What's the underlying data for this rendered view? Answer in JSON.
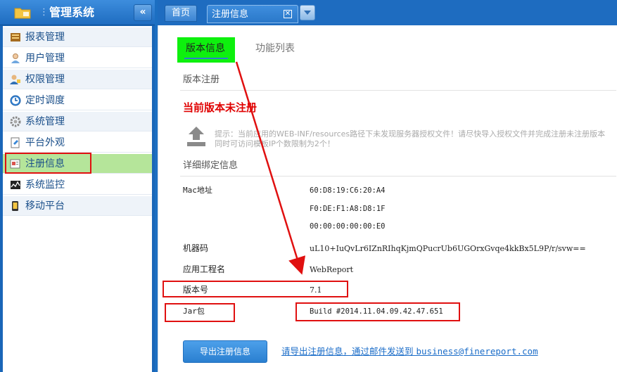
{
  "sidebar": {
    "title": "管理系统",
    "collapse_glyph": "«",
    "items": [
      {
        "label": "报表管理",
        "icon": "report-icon"
      },
      {
        "label": "用户管理",
        "icon": "user-icon"
      },
      {
        "label": "权限管理",
        "icon": "permission-icon"
      },
      {
        "label": "定时调度",
        "icon": "clock-icon"
      },
      {
        "label": "系统管理",
        "icon": "gear-icon"
      },
      {
        "label": "平台外观",
        "icon": "appearance-icon"
      },
      {
        "label": "注册信息",
        "icon": "register-icon"
      },
      {
        "label": "系统监控",
        "icon": "monitor-icon"
      },
      {
        "label": "移动平台",
        "icon": "mobile-icon"
      }
    ]
  },
  "tabs": {
    "home": "首页",
    "current": "注册信息",
    "close_glyph": "✕"
  },
  "content": {
    "subtabs": {
      "version": "版本信息",
      "features": "功能列表"
    },
    "section_register": "版本注册",
    "unregistered": "当前版本未注册",
    "tip": "提示：当前应用的WEB-INF/resources路径下未发现服务器授权文件！请尽快导入授权文件并完成注册未注册版本同时可访问模板IP个数限制为2个！",
    "section_binding": "详细绑定信息",
    "mac_label": "Mac地址",
    "mac_values": [
      "60:D8:19:C6:20:A4",
      "F0:DE:F1:A8:D8:1F",
      "00:00:00:00:00:E0"
    ],
    "machine_label": "机器码",
    "machine_value": "uL10+IuQvLr6IZnRIhqKjmQPucrUb6UGOrxGvqe4kkBx5L9P/r/svw==",
    "app_label": "应用工程名",
    "app_value": "WebReport",
    "version_label": "版本号",
    "version_value": "7.1",
    "jar_label": "Jar包",
    "jar_value": "Build #2014.11.04.09.42.47.651",
    "export_button": "导出注册信息",
    "export_hint": "请导出注册信息，通过邮件发送到",
    "export_email": "business@finereport.com"
  },
  "colors": {
    "annotation_red": "#e01010",
    "highlight_green": "#0ef00e",
    "active_item": "#b5e59a",
    "header_blue": "#1e6cc0"
  }
}
